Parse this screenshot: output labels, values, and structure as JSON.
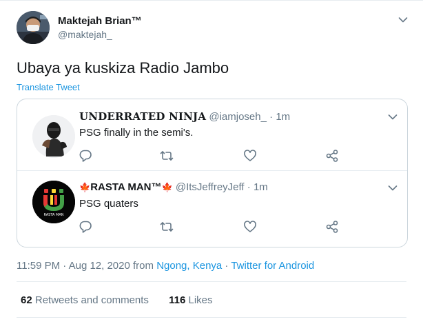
{
  "tweet": {
    "author_name": "Maktejah Brian™",
    "author_handle": "@maktejah_",
    "text": "Ubaya ya kuskiza Radio Jambo",
    "translate_label": "Translate Tweet",
    "avatar_icon": "user-avatar-photo",
    "more_icon": "chevron-down-icon"
  },
  "thread": {
    "replies": [
      {
        "name": "UNDERRATED NINJA",
        "handle": "@iamjoseh_",
        "separator": "·",
        "time": "1m",
        "text": "PSG finally in the semi's.",
        "avatar_icon": "ninja-avatar"
      },
      {
        "name_prefix": "🍁",
        "name": "RASTA MAN™",
        "name_suffix": "🍁",
        "handle": "@ItsJeffreyJeff",
        "separator": "·",
        "time": "1m",
        "text": "PSG quaters",
        "avatar_icon": "rasta-man-logo",
        "avatar_caption": "RASTA MAN"
      }
    ],
    "action_icons": [
      "reply-icon",
      "retweet-icon",
      "like-icon",
      "share-icon"
    ]
  },
  "meta": {
    "timestamp": "11:59 PM · Aug 12, 2020 from ",
    "location": "Ngong, Kenya",
    "separator": " · ",
    "source": "Twitter for Android"
  },
  "stats": {
    "retweets_count": "62",
    "retweets_label": "Retweets and comments",
    "likes_count": "116",
    "likes_label": "Likes"
  },
  "colors": {
    "link": "#1b95e0",
    "secondary_text": "#657786",
    "border": "#ccd6dd",
    "divider": "#e6ecf0"
  }
}
